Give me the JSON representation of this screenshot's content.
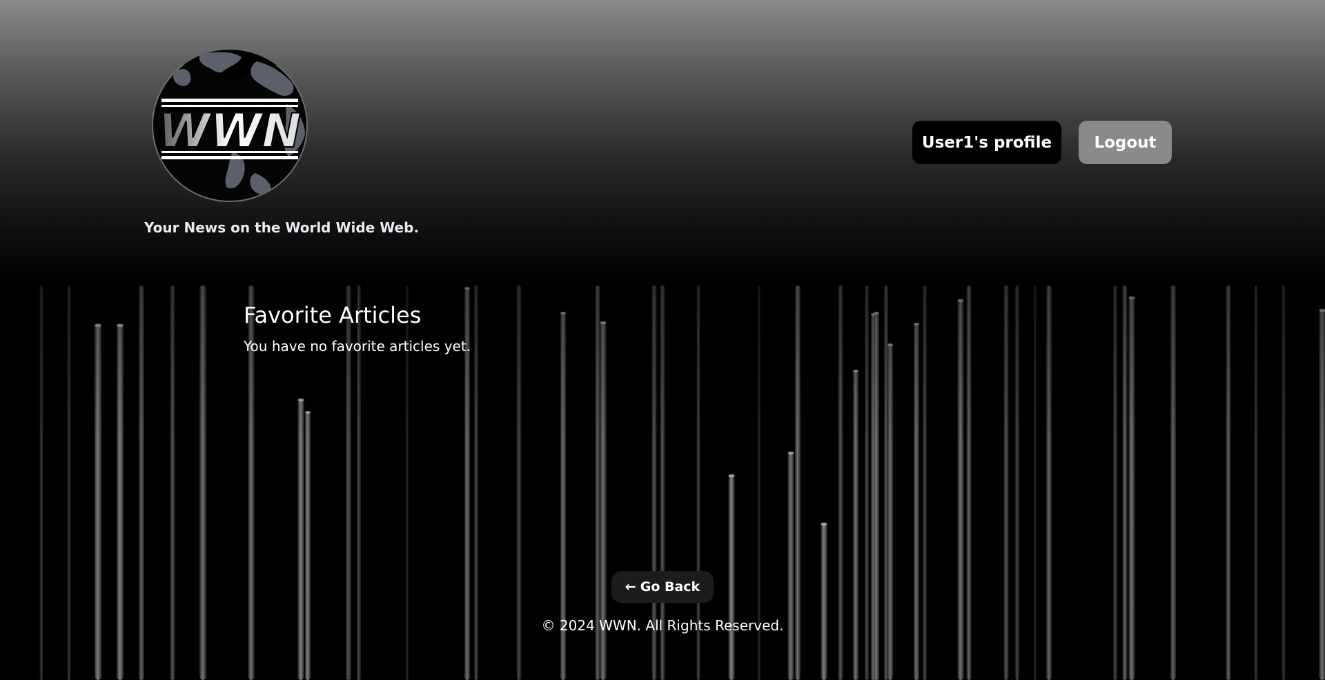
{
  "header": {
    "logo_text": "WWN",
    "tagline": "Your News on the World Wide Web."
  },
  "nav": {
    "profile_label": "User1's profile",
    "logout_label": "Logout"
  },
  "main": {
    "title": "Favorite Articles",
    "empty_message": "You have no favorite articles yet."
  },
  "actions": {
    "back_arrow": "←",
    "back_label": "Go Back"
  },
  "footer": {
    "copyright": "© 2024 WWN. All Rights Reserved."
  },
  "colors": {
    "header_top": "#8a8a8a",
    "background": "#000000",
    "profile_button": "#000000",
    "logout_button": "#8a8a8a",
    "back_button": "#1c1c1c"
  }
}
